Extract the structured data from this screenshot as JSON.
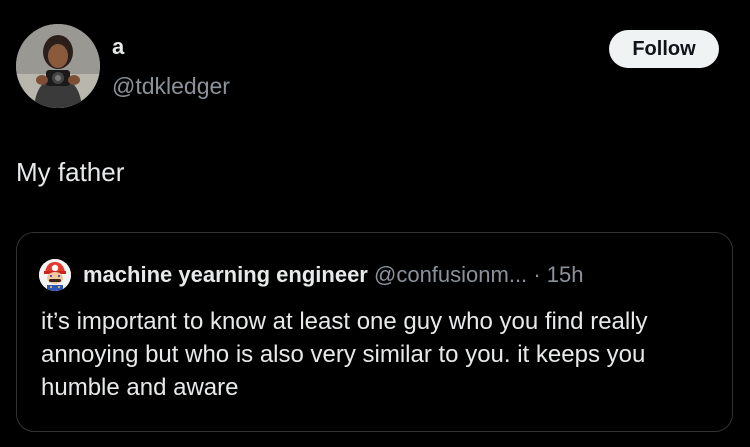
{
  "author": {
    "display_name": "a",
    "handle": "@tdkledger",
    "avatar_icon": "person-with-camera-avatar"
  },
  "follow_button": {
    "label": "Follow"
  },
  "post": {
    "text": "My father"
  },
  "quoted_post": {
    "display_name": "machine yearning engineer",
    "handle": "@confusionm...",
    "separator": "·",
    "time": "15h",
    "avatar_icon": "mario-avatar",
    "text": "it’s important to know at least one guy who you find really annoying but who is also very similar to you. it keeps you humble and aware"
  },
  "colors": {
    "background": "#000000",
    "primary_text": "#e7e9ea",
    "secondary_text": "#8b9299",
    "border": "#2f3336",
    "button_bg": "#eff3f4"
  }
}
